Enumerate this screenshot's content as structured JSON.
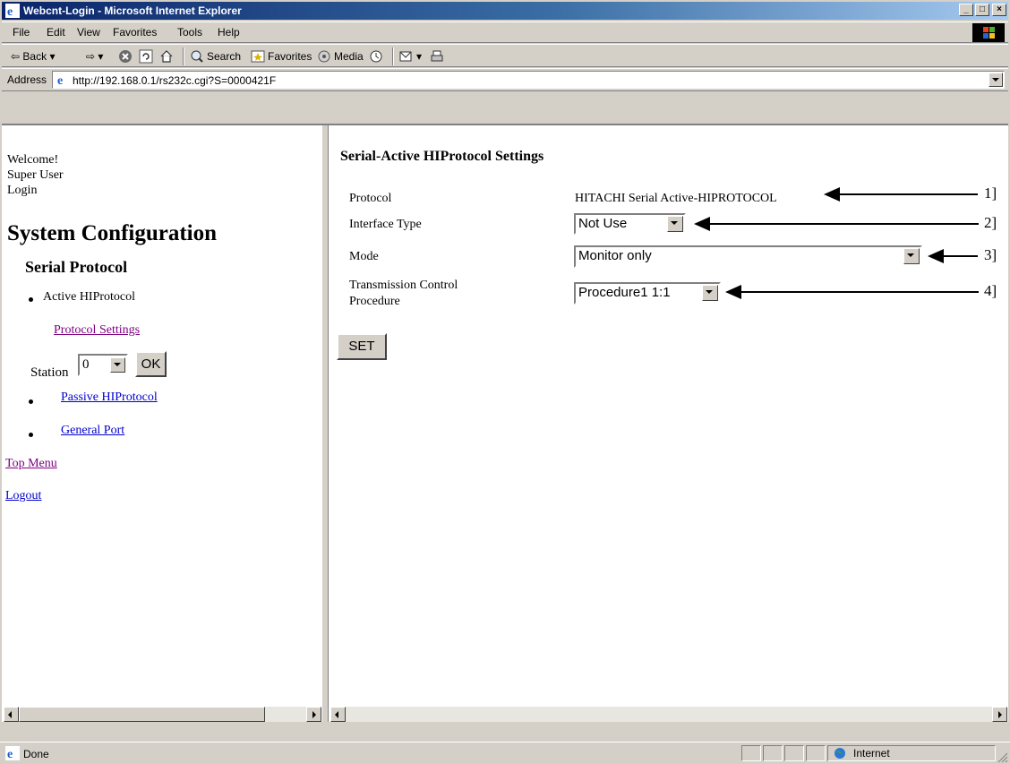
{
  "window": {
    "title": "Webcnt-Login - Microsoft Internet Explorer",
    "buttons": [
      "_",
      "□",
      "×"
    ]
  },
  "menu": [
    "File",
    "Edit",
    "View",
    "Favorites",
    "Tools",
    "Help"
  ],
  "toolbar": {
    "back": "Back",
    "search": "Search",
    "favorites": "Favorites",
    "media": "Media"
  },
  "address": {
    "label": "Address",
    "url": "http://192.168.0.1/rs232c.cgi?S=0000421F"
  },
  "left": {
    "welcome": "Welcome!",
    "user": "Super User",
    "login": "Login",
    "heading": "System Configuration",
    "subheading": "Serial Protocol",
    "active": "Active HIProtocol",
    "protocol_settings": "Protocol Settings",
    "station_label": "Station",
    "station_value": "0",
    "ok": "OK",
    "passive": "Passive HIProtocol",
    "general": "General Port",
    "top_menu": "Top Menu",
    "logout": "Logout"
  },
  "right": {
    "title": "Serial-Active HIProtocol Settings",
    "protocol_label": "Protocol",
    "protocol_value": "HITACHI Serial Active-HIPROTOCOL",
    "interface_label": "Interface Type",
    "interface_value": "Not Use",
    "mode_label": "Mode",
    "mode_value": "Monitor only",
    "tcp_label_1": "Transmission Control",
    "tcp_label_2": "Procedure",
    "tcp_value": "Procedure1 1:1",
    "set": "SET"
  },
  "callouts": [
    "1]",
    "2]",
    "3]",
    "4]"
  ],
  "status": {
    "text": "Done",
    "zone": "Internet"
  }
}
